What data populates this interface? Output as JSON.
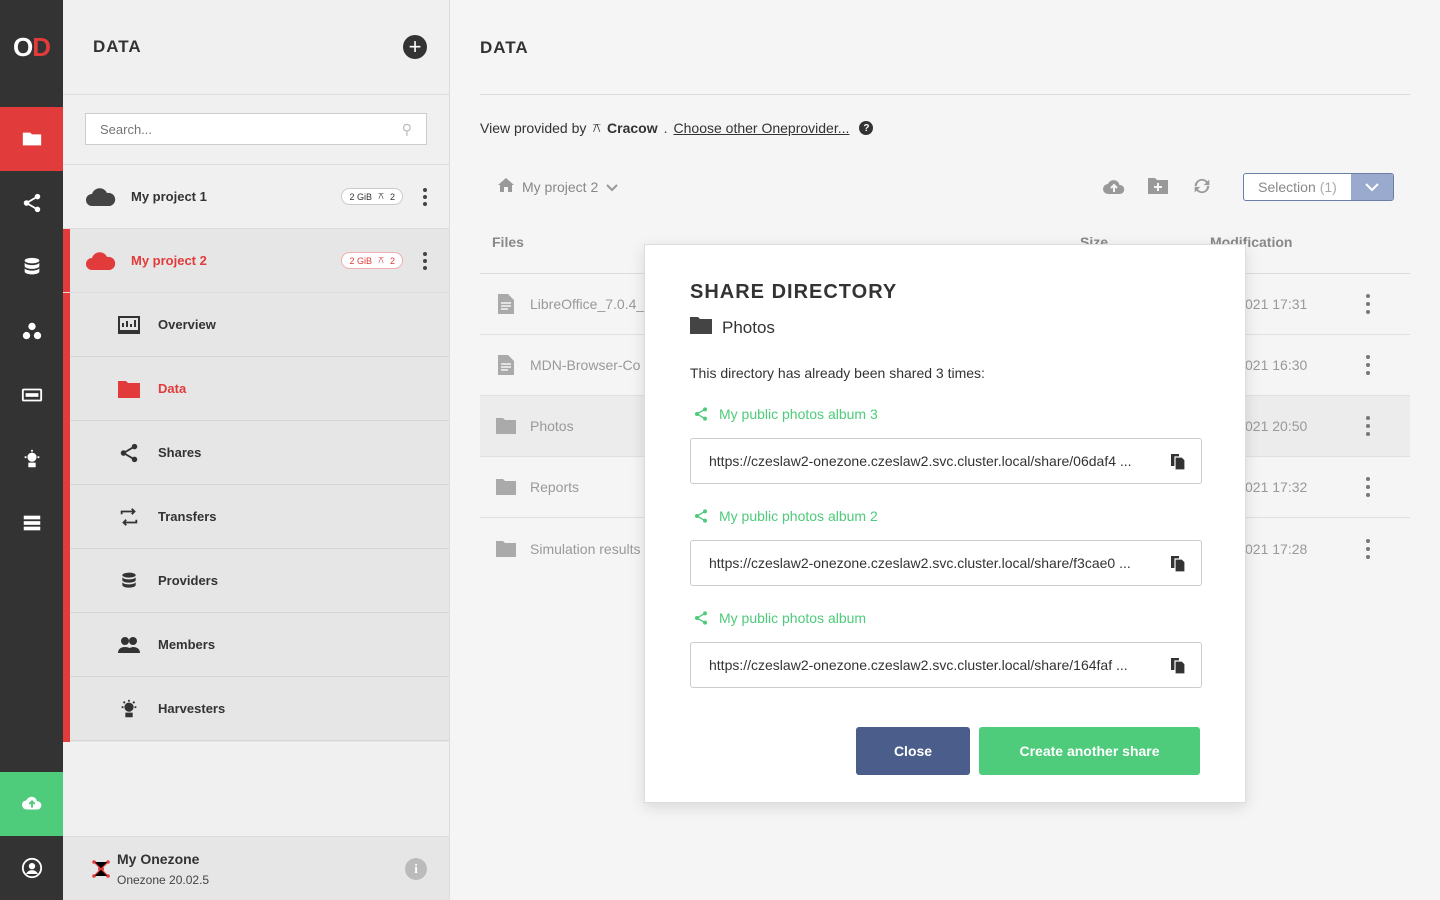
{
  "rail": {
    "logo_left": "O",
    "logo_right": "D",
    "items": [
      "data-icon",
      "share-icon",
      "provider-icon",
      "groups-icon",
      "tokens-icon",
      "harvester-icon",
      "clusters-icon"
    ],
    "accent": "#e13b3b",
    "upload_color": "#4ecb7b"
  },
  "sidebar": {
    "title": "DATA",
    "search_placeholder": "Search...",
    "spaces": [
      {
        "name": "My project 1",
        "size": "2 GiB",
        "providers": "2"
      },
      {
        "name": "My project 2",
        "size": "2 GiB",
        "providers": "2"
      }
    ],
    "submenu": [
      {
        "label": "Overview",
        "icon": "overview-icon"
      },
      {
        "label": "Data",
        "icon": "folder-icon"
      },
      {
        "label": "Shares",
        "icon": "share-icon"
      },
      {
        "label": "Transfers",
        "icon": "transfer-icon"
      },
      {
        "label": "Providers",
        "icon": "provider-icon"
      },
      {
        "label": "Members",
        "icon": "members-icon"
      },
      {
        "label": "Harvesters",
        "icon": "harvester-icon"
      }
    ],
    "footer": {
      "name": "My Onezone",
      "version": "Onezone 20.02.5"
    }
  },
  "main": {
    "title": "DATA",
    "provider_prefix": "View provided by",
    "provider_name": "Cracow",
    "provider_link": "Choose other Oneprovider...",
    "breadcrumb": "My project 2",
    "selection_label": "Selection",
    "selection_count": "(1)",
    "columns": {
      "files": "Files",
      "size": "Size",
      "modification": "Modification"
    },
    "rows": [
      {
        "name": "LibreOffice_7.0.4_",
        "date": "021 17:31",
        "type": "file"
      },
      {
        "name": "MDN-Browser-Co",
        "date": "021 16:30",
        "type": "file"
      },
      {
        "name": "Photos",
        "date": "021 20:50",
        "type": "folder"
      },
      {
        "name": "Reports",
        "date": "021 17:32",
        "type": "folder"
      },
      {
        "name": "Simulation results",
        "date": "021 17:28",
        "type": "folder"
      }
    ]
  },
  "modal": {
    "title": "SHARE DIRECTORY",
    "directory": "Photos",
    "info": "This directory has already been shared 3 times:",
    "shares": [
      {
        "name": "My public photos album 3",
        "url": "https://czeslaw2-onezone.czeslaw2.svc.cluster.local/share/06daf4 ..."
      },
      {
        "name": "My public photos album 2",
        "url": "https://czeslaw2-onezone.czeslaw2.svc.cluster.local/share/f3cae0 ..."
      },
      {
        "name": "My public photos album",
        "url": "https://czeslaw2-onezone.czeslaw2.svc.cluster.local/share/164faf ..."
      }
    ],
    "close_label": "Close",
    "create_label": "Create another share"
  }
}
